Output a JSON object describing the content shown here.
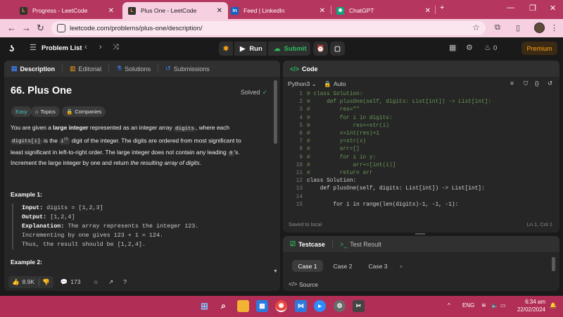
{
  "browser": {
    "tabs": [
      {
        "title": "Progress - LeetCode",
        "icon": "leetcode-icon",
        "color": "#ffa116"
      },
      {
        "title": "Plus One - LeetCode",
        "icon": "leetcode-icon",
        "color": "#ffa116"
      },
      {
        "title": "Feed | LinkedIn",
        "icon": "linkedin-icon",
        "color": "#0a66c2"
      },
      {
        "title": "ChatGPT",
        "icon": "chatgpt-icon",
        "color": "#10a37f"
      }
    ],
    "url": "leetcode.com/problems/plus-one/description/"
  },
  "lc_nav": {
    "problem_list": "Problem List",
    "run": "Run",
    "submit": "Submit",
    "points": "0",
    "premium": "Premium"
  },
  "description_panel": {
    "tabs": [
      "Description",
      "Editorial",
      "Solutions",
      "Submissions"
    ],
    "title": "66. Plus One",
    "status": "Solved",
    "tags": [
      "Easy",
      "Topics",
      "Companies"
    ],
    "para1_a": "You are given a ",
    "para1_b": "large integer",
    "para1_c": " represented as an integer array ",
    "para1_code1": "digits",
    "para1_d": ", where each",
    "para1_code2": "digits[i]",
    "para1_e": " is the ",
    "para1_f": "i",
    "para1_sup": "th",
    "para1_g": " digit of the integer. The digits are ordered from most significant to",
    "para1_h": "least significant in left-to-right order. The large integer does not contain any leading ",
    "para1_code3": "0",
    "para1_i": "'s.",
    "para2_a": "Increment the large integer by one and return ",
    "para2_b": "the resulting array of digits",
    "para2_c": ".",
    "example1": {
      "heading": "Example 1:",
      "input_label": "Input:",
      "input": " digits = [1,2,3]",
      "output_label": "Output:",
      "output": " [1,2,4]",
      "explanation_label": "Explanation:",
      "explanation": " The array represents the integer 123.",
      "line4": "Incrementing by one gives 123 + 1 = 124.",
      "line5": "Thus, the result should be [1,2,4]."
    },
    "example2_heading": "Example 2:",
    "likes": "8.9K",
    "comments": "173"
  },
  "code_panel": {
    "title": "Code",
    "language": "Python3",
    "mode": "Auto",
    "saved": "Saved to local",
    "position": "Ln 1, Col 1",
    "lines": [
      {
        "n": "1",
        "t": "# class Solution:"
      },
      {
        "n": "2",
        "t": "#     def plusOne(self, digits: List[int]) -> List[int]:"
      },
      {
        "n": "3",
        "t": "#         res=\"\""
      },
      {
        "n": "4",
        "t": "#         for i in digits:"
      },
      {
        "n": "5",
        "t": "#             res+=str(i)"
      },
      {
        "n": "6",
        "t": "#         x=int(res)+1"
      },
      {
        "n": "7",
        "t": "#         y=str(x)"
      },
      {
        "n": "8",
        "t": "#         arr=[]"
      },
      {
        "n": "9",
        "t": "#         for i in y:"
      },
      {
        "n": "10",
        "t": "#             arr+=[int(i)]"
      },
      {
        "n": "11",
        "t": "#         return arr"
      },
      {
        "n": "12",
        "t": "class Solution:"
      },
      {
        "n": "13",
        "t": "    def plusOne(self, digits: List[int]) -> List[int]:"
      },
      {
        "n": "14",
        "t": ""
      },
      {
        "n": "15",
        "t": "        for i in range(len(digits)-1, -1, -1):"
      }
    ]
  },
  "testcase_panel": {
    "tabs": [
      "Testcase",
      "Test Result"
    ],
    "cases": [
      "Case 1",
      "Case 2",
      "Case 3"
    ],
    "add": "+",
    "source": "Source"
  },
  "taskbar": {
    "lang": "ENG",
    "time": "6:34 am",
    "date": "22/02/2024"
  }
}
